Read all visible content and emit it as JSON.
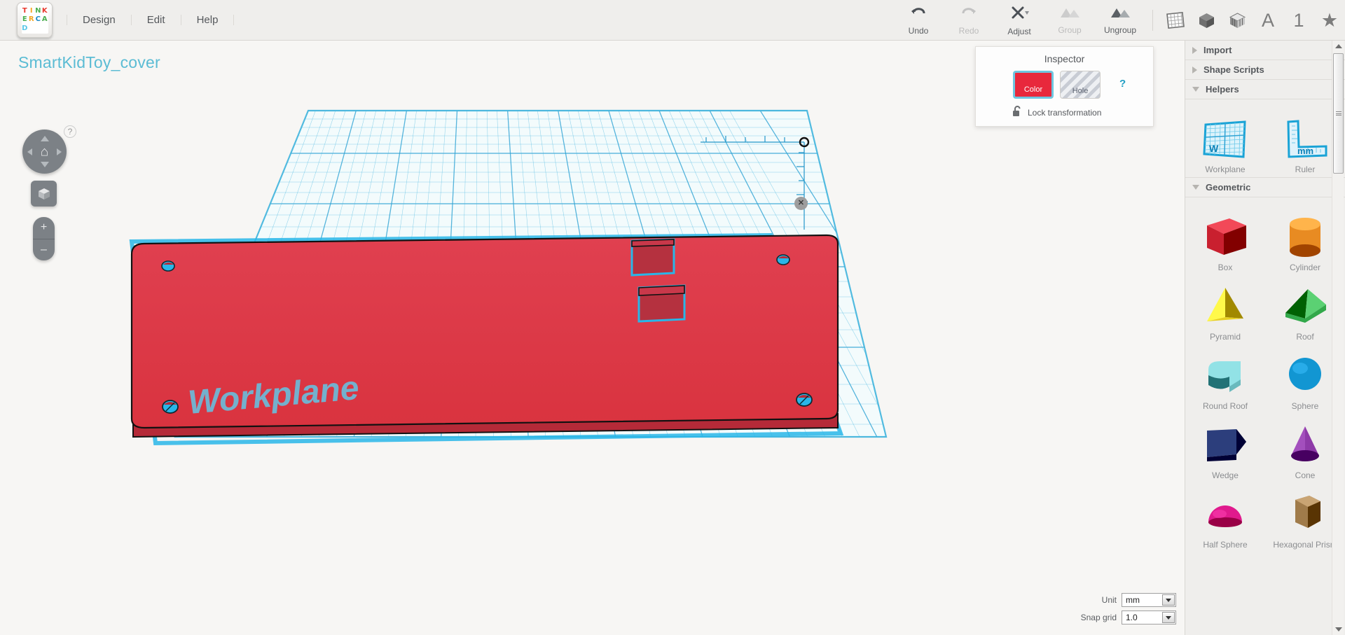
{
  "app": {
    "logo_letters": [
      {
        "ch": "T",
        "color": "#e8392e"
      },
      {
        "ch": "I",
        "color": "#f5a623"
      },
      {
        "ch": "N",
        "color": "#4caf50"
      },
      {
        "ch": "K",
        "color": "#e8392e"
      },
      {
        "ch": "E",
        "color": "#4caf50"
      },
      {
        "ch": "R",
        "color": "#f5a623"
      },
      {
        "ch": "C",
        "color": "#1b8ac4"
      },
      {
        "ch": "A",
        "color": "#4caf50"
      },
      {
        "ch": "D",
        "color": "#5bc8e8"
      }
    ],
    "logo_name": "tinkercad-logo"
  },
  "menu": {
    "items": [
      {
        "label": "Design",
        "name": "menu-design"
      },
      {
        "label": "Edit",
        "name": "menu-edit"
      },
      {
        "label": "Help",
        "name": "menu-help"
      }
    ]
  },
  "toolbar": {
    "undo": "Undo",
    "redo": "Redo",
    "adjust": "Adjust",
    "group": "Group",
    "ungroup": "Ungroup",
    "icons": [
      {
        "name": "workplane-grid-icon"
      },
      {
        "name": "solid-cube-icon"
      },
      {
        "name": "shaded-cube-icon"
      },
      {
        "name": "text-a-icon",
        "glyph": "A"
      },
      {
        "name": "number-one-icon",
        "glyph": "1"
      },
      {
        "name": "star-icon",
        "glyph": "★"
      }
    ]
  },
  "canvas": {
    "design_title": "SmartKidToy_cover",
    "workplane_label": "Workplane",
    "ruler_unit": "mm",
    "help_badge": "?",
    "nav": {
      "home_glyph": "⌂",
      "zoom_in": "+",
      "zoom_out": "–"
    },
    "close_glyph": "✕"
  },
  "inspector": {
    "title": "Inspector",
    "color_label": "Color",
    "hole_label": "Hole",
    "lock_label": "Lock transformation",
    "help": "?",
    "color_hex": "#e8283c"
  },
  "units": {
    "unit_label": "Unit",
    "unit_value": "mm",
    "snap_label": "Snap grid",
    "snap_value": "1.0"
  },
  "right_panel": {
    "sections": [
      {
        "label": "Import",
        "expanded": false,
        "name": "section-import"
      },
      {
        "label": "Shape Scripts",
        "expanded": false,
        "name": "section-shape-scripts"
      },
      {
        "label": "Helpers",
        "expanded": true,
        "name": "section-helpers"
      },
      {
        "label": "Geometric",
        "expanded": true,
        "name": "section-geometric"
      }
    ],
    "helpers": [
      {
        "label": "Workplane",
        "name": "shape-workplane",
        "glyph": "W"
      },
      {
        "label": "Ruler",
        "name": "shape-ruler",
        "glyph": "mm"
      }
    ],
    "geometric": [
      {
        "label": "Box",
        "name": "shape-box",
        "color": "#c9202f",
        "kind": "box"
      },
      {
        "label": "Cylinder",
        "name": "shape-cylinder",
        "color": "#e88b22",
        "kind": "cylinder"
      },
      {
        "label": "Pyramid",
        "name": "shape-pyramid",
        "color": "#e8d021",
        "kind": "pyramid"
      },
      {
        "label": "Roof",
        "name": "shape-roof",
        "color": "#32a84a",
        "kind": "roof"
      },
      {
        "label": "Round Roof",
        "name": "shape-round-roof",
        "color": "#69b9bd",
        "kind": "roundroof"
      },
      {
        "label": "Sphere",
        "name": "shape-sphere",
        "color": "#1296d2",
        "kind": "sphere"
      },
      {
        "label": "Wedge",
        "name": "shape-wedge",
        "color": "#2c3e7c",
        "kind": "wedge"
      },
      {
        "label": "Cone",
        "name": "shape-cone",
        "color": "#8e3aa8",
        "kind": "cone"
      },
      {
        "label": "Half Sphere",
        "name": "shape-half-sphere",
        "color": "#e01a8d",
        "kind": "halfsphere"
      },
      {
        "label": "Hexagonal Prism",
        "name": "shape-hex-prism",
        "color": "#a07b4a",
        "kind": "hex"
      }
    ]
  },
  "model": {
    "body_color": "#dc3545",
    "side_color": "#b52a38",
    "outline_color": "#1a1a1a",
    "select_color": "#29b6e8",
    "hole_color": "#b03040",
    "grid_color": "#4cb8e0"
  }
}
